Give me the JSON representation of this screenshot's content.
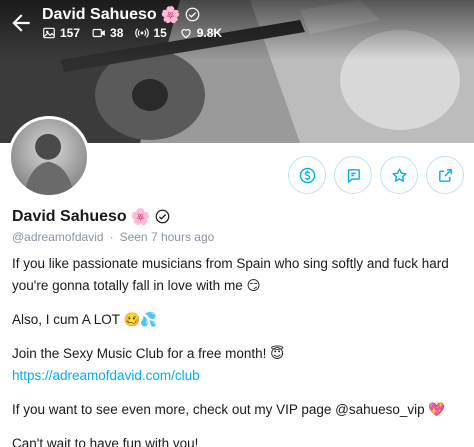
{
  "header": {
    "name": "David Sahueso",
    "name_emoji": "🌸",
    "stats": {
      "photos": "157",
      "videos": "38",
      "streams": "15",
      "likes": "9.8K"
    }
  },
  "profile": {
    "name": "David Sahueso",
    "name_emoji": "🌸",
    "handle": "@adreamofdavid",
    "separator": "·",
    "seen": "Seen  7 hours ago"
  },
  "bio": {
    "p1": "If you like passionate musicians from Spain who sing softly and fuck hard you're gonna totally fall in love with me 😏",
    "p2": "Also, I cum A LOT 🥴💦",
    "p3_text": "Join the Sexy Music Club for a free month! 😇 ",
    "p3_link": "https://adreamofdavid.com/club",
    "p4": "If you want to see even more, check out my VIP page @sahueso_vip 💖",
    "p5": "Can't wait to have fun with you!"
  },
  "colors": {
    "accent": "#00aff0",
    "muted": "#8a96a3",
    "button_border": "#bfe1f4"
  }
}
